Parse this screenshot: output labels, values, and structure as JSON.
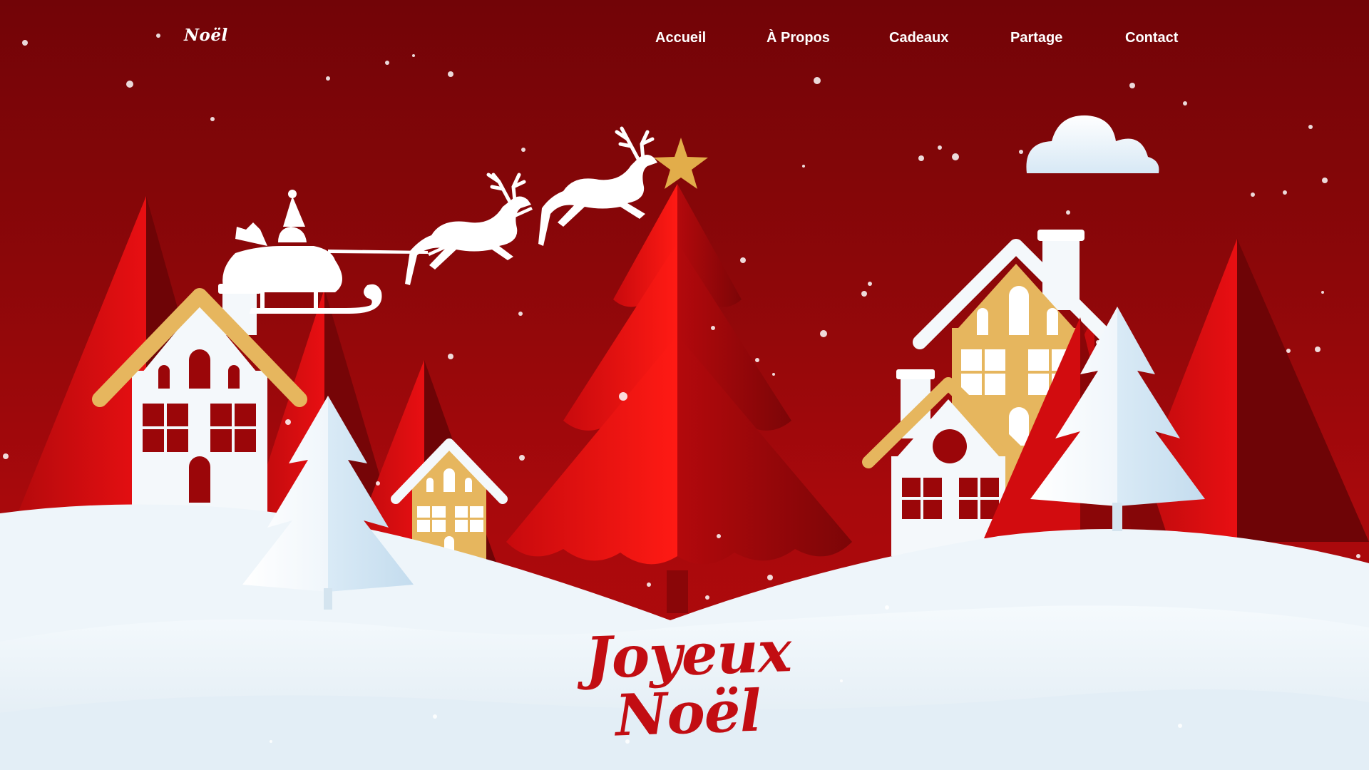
{
  "header": {
    "brand": "Noël",
    "nav": [
      {
        "label": "Accueil"
      },
      {
        "label": "À Propos"
      },
      {
        "label": "Cadeaux"
      },
      {
        "label": "Partage"
      },
      {
        "label": "Contact"
      }
    ]
  },
  "hero": {
    "title_line1": "Joyeux",
    "title_line2": "Noël"
  },
  "colors": {
    "background_red": "#8c0709",
    "tree_red": "#e40d10",
    "snow": "#eef6fb",
    "gold": "#e6b65e",
    "star": "#e2ad4a",
    "title_red": "#c20d12"
  },
  "icons": [
    "star-icon",
    "cloud-icon",
    "santa-sleigh-icon",
    "reindeer-icon"
  ]
}
